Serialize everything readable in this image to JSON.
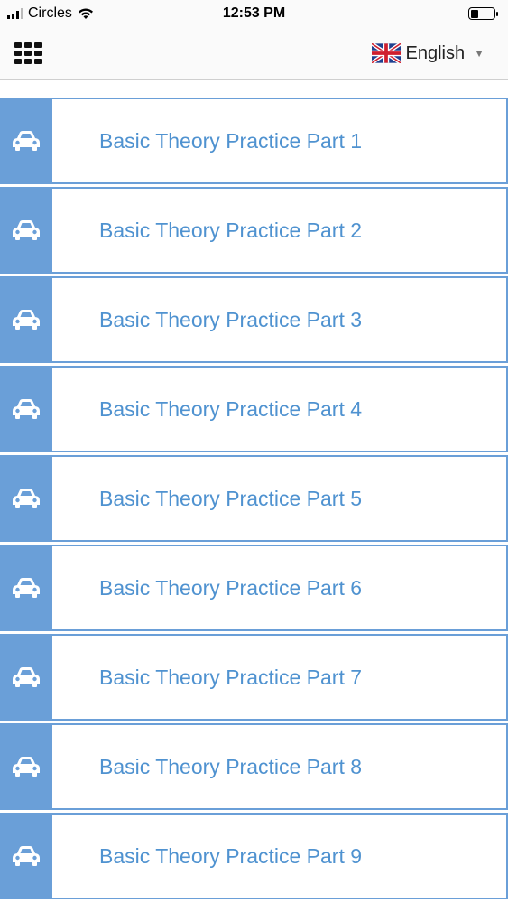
{
  "status_bar": {
    "carrier": "Circles",
    "time": "12:53 PM"
  },
  "header": {
    "language": "English",
    "language_flag_icon": "uk-flag-icon",
    "menu_icon": "grid-menu-icon"
  },
  "colors": {
    "accent": "#6a9fd8",
    "label_text": "#4f92d0"
  },
  "lessons": [
    {
      "label": "Basic Theory Practice Part 1",
      "icon": "car-icon"
    },
    {
      "label": "Basic Theory Practice Part 2",
      "icon": "car-icon"
    },
    {
      "label": "Basic Theory Practice Part 3",
      "icon": "car-icon"
    },
    {
      "label": "Basic Theory Practice Part 4",
      "icon": "car-icon"
    },
    {
      "label": "Basic Theory Practice Part 5",
      "icon": "car-icon"
    },
    {
      "label": "Basic Theory Practice Part 6",
      "icon": "car-icon"
    },
    {
      "label": "Basic Theory Practice Part 7",
      "icon": "car-icon"
    },
    {
      "label": "Basic Theory Practice Part 8",
      "icon": "car-icon"
    },
    {
      "label": "Basic Theory Practice Part 9",
      "icon": "car-icon"
    }
  ]
}
